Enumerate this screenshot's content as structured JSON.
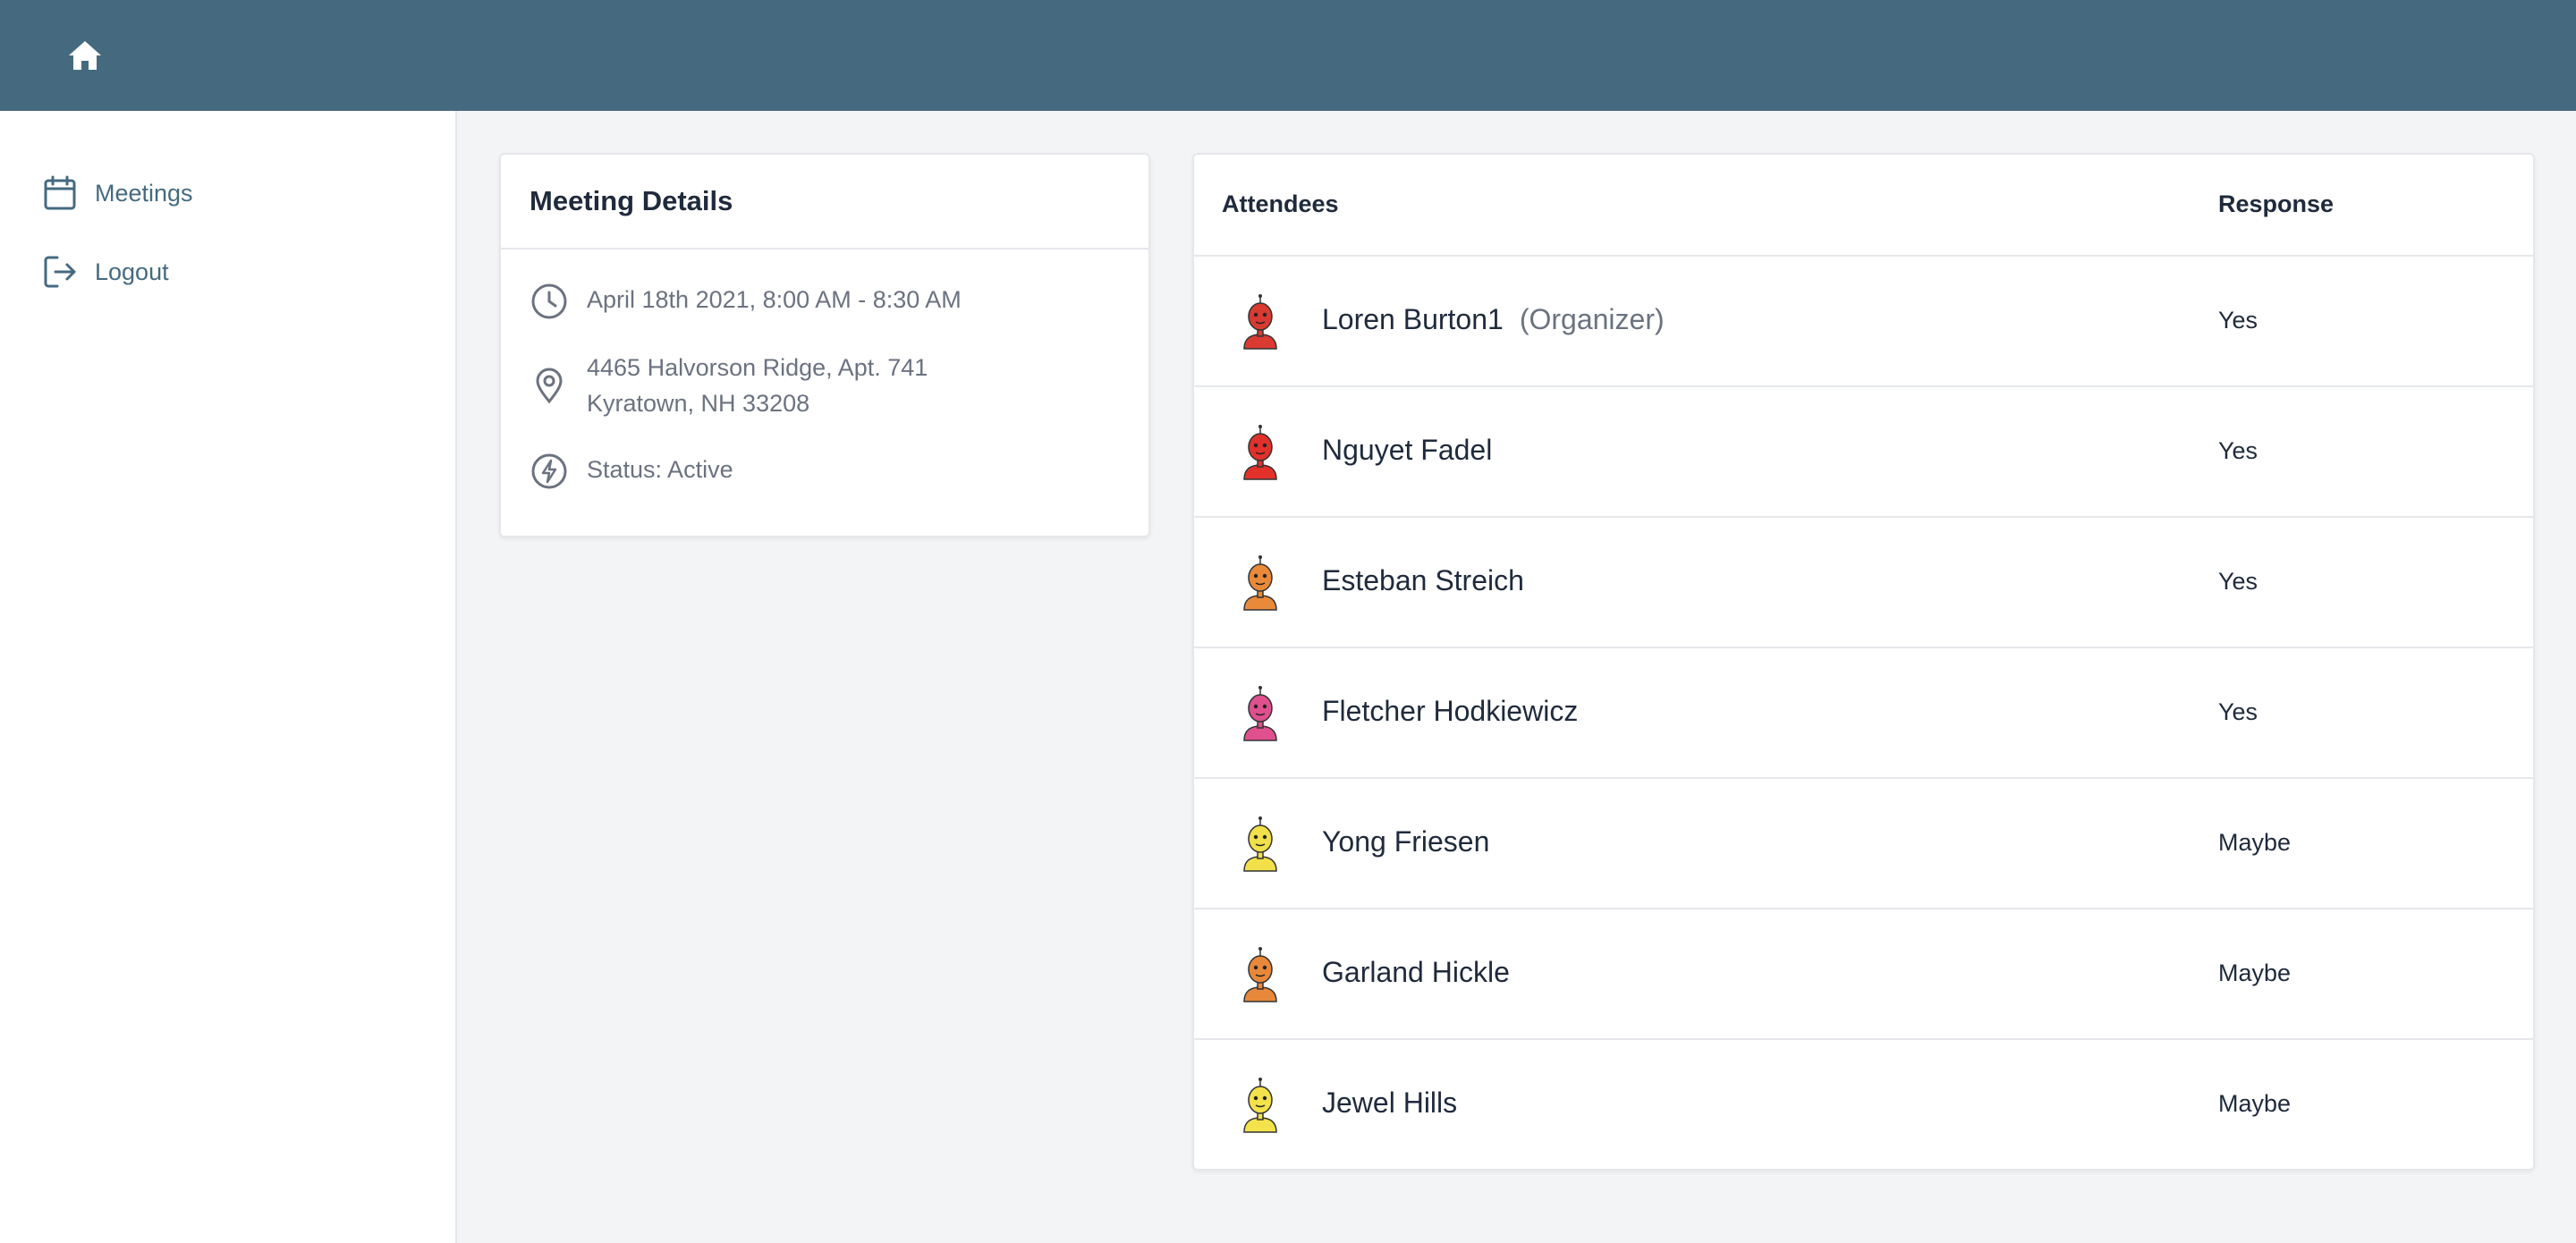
{
  "header": {
    "home_icon": "home-icon"
  },
  "sidebar": {
    "items": [
      {
        "label": "Meetings",
        "icon": "calendar-icon"
      },
      {
        "label": "Logout",
        "icon": "logout-icon"
      }
    ]
  },
  "meeting_details": {
    "title": "Meeting Details",
    "datetime": "April 18th 2021, 8:00 AM - 8:30 AM",
    "address_line1": "4465 Halvorson Ridge, Apt. 741",
    "address_line2": "Kyratown, NH 33208",
    "status": "Status: Active"
  },
  "attendees": {
    "header_name": "Attendees",
    "header_response": "Response",
    "rows": [
      {
        "name": "Loren Burton1",
        "role": "(Organizer)",
        "response": "Yes",
        "avatar_color": "#d93a32"
      },
      {
        "name": "Nguyet Fadel",
        "role": "",
        "response": "Yes",
        "avatar_color": "#e2312b"
      },
      {
        "name": "Esteban Streich",
        "role": "",
        "response": "Yes",
        "avatar_color": "#e98a3a"
      },
      {
        "name": "Fletcher Hodkiewicz",
        "role": "",
        "response": "Yes",
        "avatar_color": "#e0508e"
      },
      {
        "name": "Yong Friesen",
        "role": "",
        "response": "Maybe",
        "avatar_color": "#f1e04a"
      },
      {
        "name": "Garland Hickle",
        "role": "",
        "response": "Maybe",
        "avatar_color": "#e8883a"
      },
      {
        "name": "Jewel Hills",
        "role": "",
        "response": "Maybe",
        "avatar_color": "#f3e24a"
      }
    ]
  },
  "colors": {
    "topbar": "#456a80",
    "nav_text": "#456a80",
    "background": "#f3f4f6"
  }
}
